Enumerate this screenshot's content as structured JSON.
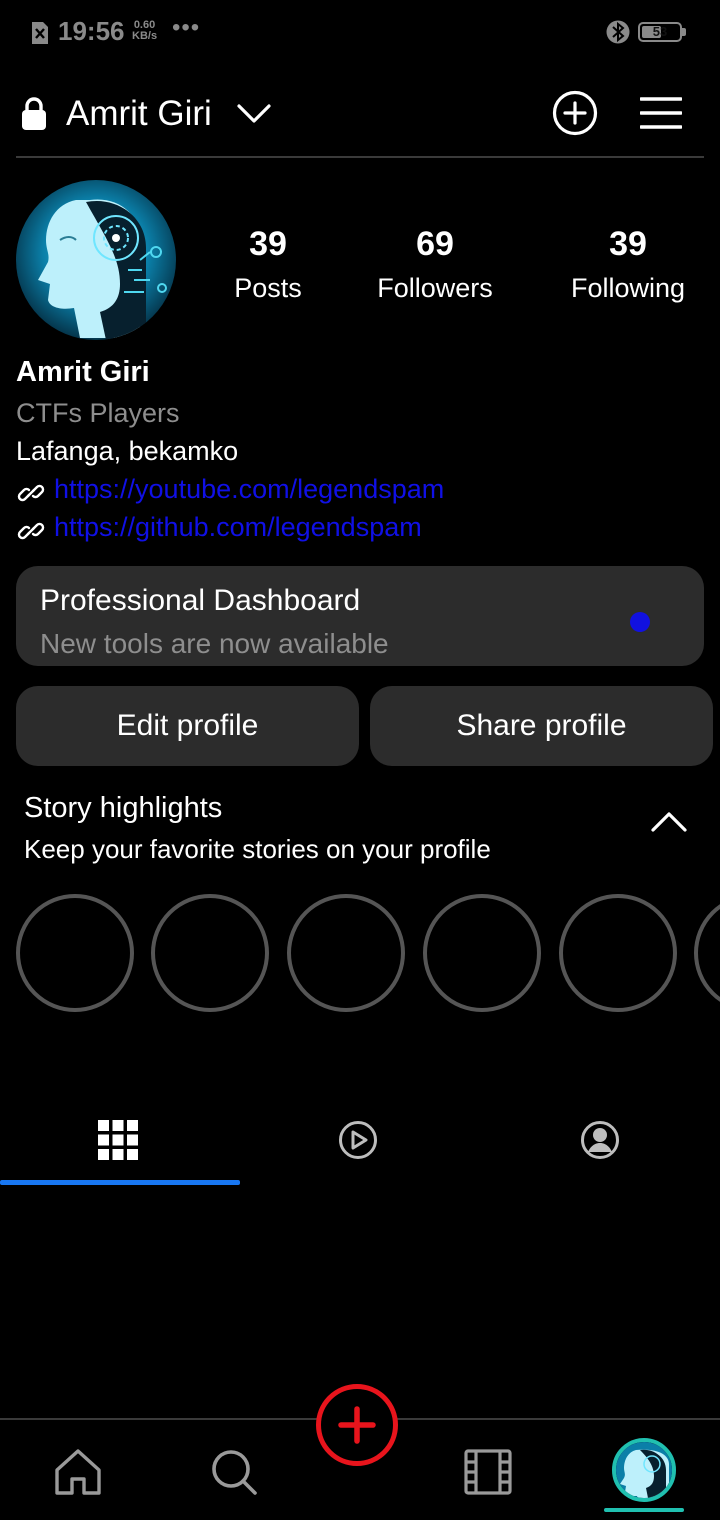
{
  "status_bar": {
    "time": "19:56",
    "net_speed_value": "0.60",
    "net_speed_unit": "KB/s",
    "overflow": "•••",
    "battery": "53",
    "battery_level": 0.53
  },
  "header": {
    "username": "Amrit Giri"
  },
  "profile": {
    "stats": [
      {
        "value": "39",
        "label": "Posts"
      },
      {
        "value": "69",
        "label": "Followers"
      },
      {
        "value": "39",
        "label": "Following"
      }
    ],
    "display_name": "Amrit Giri",
    "category": "CTFs Players",
    "bio": "Lafanga, bekamko",
    "links": [
      "https://youtube.com/legendspam",
      "https://github.com/legendspam"
    ]
  },
  "dashboard": {
    "title": "Professional Dashboard",
    "subtitle": "New tools are now available",
    "dot_color": "#1111e0"
  },
  "buttons": {
    "edit_profile": "Edit profile",
    "share_profile": "Share profile"
  },
  "highlights": {
    "title": "Story highlights",
    "subtitle": "Keep your favorite stories on your profile"
  },
  "tabs": [
    {
      "icon": "grid-icon",
      "active": true
    },
    {
      "icon": "reels-play-icon",
      "active": false
    },
    {
      "icon": "tagged-person-icon",
      "active": false
    }
  ],
  "bottom_nav": [
    {
      "icon": "home-icon"
    },
    {
      "icon": "search-icon"
    },
    {
      "icon": "create-plus-icon"
    },
    {
      "icon": "reels-icon"
    },
    {
      "icon": "profile-avatar"
    }
  ],
  "colors": {
    "accent": "#1877f2",
    "link": "#1010e6",
    "create": "#e8141c",
    "profile_ring": "#20c0b0"
  }
}
